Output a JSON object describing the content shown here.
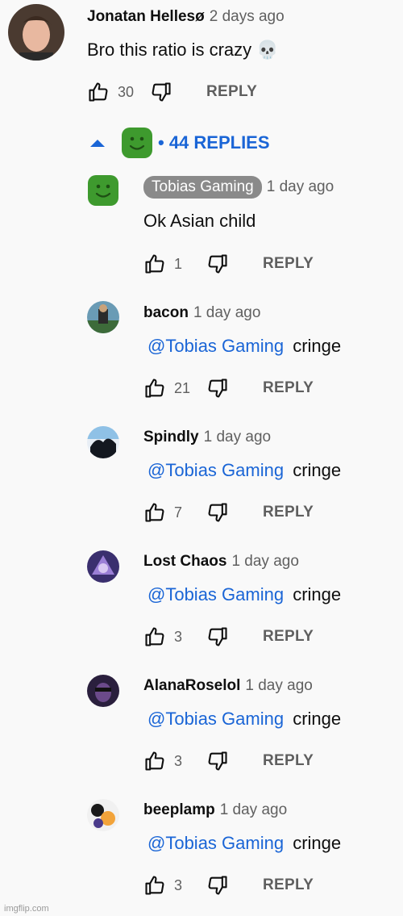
{
  "top_comment": {
    "author": "Jonatan Hellesø",
    "time": "2 days ago",
    "text": "Bro this ratio is crazy 💀",
    "likes": "30",
    "reply_label": "REPLY"
  },
  "replies_toggle": {
    "label": "• 44 REPLIES"
  },
  "replies": [
    {
      "author": "Tobias Gaming",
      "time": "1 day ago",
      "mention": "",
      "text": "Ok Asian child",
      "likes": "1",
      "reply_label": "REPLY"
    },
    {
      "author": "bacon",
      "time": "1 day ago",
      "mention": "@Tobias Gaming",
      "text": "cringe",
      "likes": "21",
      "reply_label": "REPLY"
    },
    {
      "author": "Spindly",
      "time": "1 day ago",
      "mention": "@Tobias Gaming",
      "text": "cringe",
      "likes": "7",
      "reply_label": "REPLY"
    },
    {
      "author": "Lost Chaos",
      "time": "1 day ago",
      "mention": "@Tobias Gaming",
      "text": "cringe",
      "likes": "3",
      "reply_label": "REPLY"
    },
    {
      "author": "AlanaRoselol",
      "time": "1 day ago",
      "mention": "@Tobias Gaming",
      "text": "cringe",
      "likes": "3",
      "reply_label": "REPLY"
    },
    {
      "author": "beeplamp",
      "time": "1 day ago",
      "mention": "@Tobias Gaming",
      "text": "cringe",
      "likes": "3",
      "reply_label": "REPLY"
    }
  ],
  "icons": {
    "like": "thumbs-up-icon",
    "dislike": "thumbs-down-icon",
    "collapse": "caret-up-icon"
  },
  "watermark": "imgflip.com",
  "colors": {
    "link_blue": "#1a65d6",
    "meta_gray": "#606060",
    "background": "#f9f9f9"
  }
}
